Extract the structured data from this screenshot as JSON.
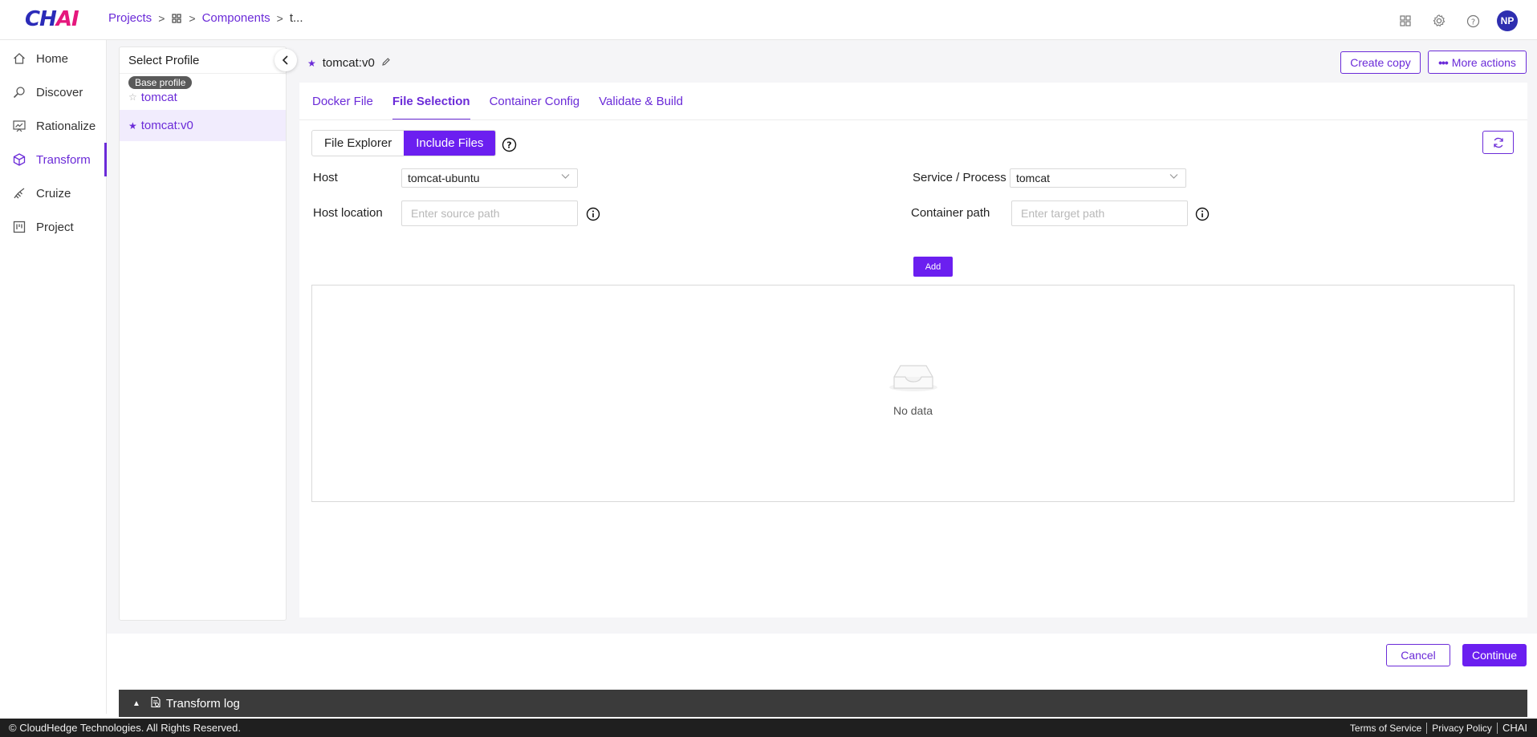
{
  "app": {
    "logo_main": "CH",
    "logo_accent": "AI"
  },
  "breadcrumb": {
    "projects": "Projects",
    "components": "Components",
    "current": "t..."
  },
  "header": {
    "avatar_initials": "NP"
  },
  "sidebar": {
    "items": [
      {
        "label": "Home",
        "icon": "home-icon"
      },
      {
        "label": "Discover",
        "icon": "discover-icon"
      },
      {
        "label": "Rationalize",
        "icon": "rationalize-icon"
      },
      {
        "label": "Transform",
        "icon": "transform-icon",
        "active": true
      },
      {
        "label": "Cruize",
        "icon": "cruize-icon"
      },
      {
        "label": "Project",
        "icon": "project-icon"
      }
    ]
  },
  "profiles": {
    "header": "Select Profile",
    "base_badge": "Base profile",
    "items": [
      {
        "name": "tomcat",
        "starred": false
      },
      {
        "name": "tomcat:v0",
        "starred": true,
        "selected": true
      }
    ]
  },
  "main": {
    "title": "tomcat:v0",
    "create_copy": "Create copy",
    "more_actions": "More actions",
    "tabs": [
      {
        "label": "Docker File"
      },
      {
        "label": "File Selection",
        "active": true
      },
      {
        "label": "Container Config"
      },
      {
        "label": "Validate & Build"
      }
    ],
    "segment": {
      "file_explorer": "File Explorer",
      "include_files": "Include Files",
      "active": "Include Files"
    },
    "form": {
      "host_label": "Host",
      "host_value": "tomcat-ubuntu",
      "service_label": "Service / Process",
      "service_value": "tomcat",
      "host_location_label": "Host location",
      "host_location_placeholder": "Enter source path",
      "container_path_label": "Container path",
      "container_path_placeholder": "Enter target path"
    },
    "add_button": "Add",
    "empty_text": "No data"
  },
  "actions": {
    "cancel": "Cancel",
    "continue": "Continue"
  },
  "log": {
    "label": "Transform log"
  },
  "footer": {
    "copyright": "© CloudHedge Technologies. All Rights Reserved.",
    "terms": "Terms of Service",
    "privacy": "Privacy Policy",
    "brand": "CHAI"
  },
  "colors": {
    "accent": "#6b1ff0",
    "accent_text": "#6b2bd8",
    "logo_blue": "#2b2bb8",
    "logo_pink": "#e5187d"
  }
}
